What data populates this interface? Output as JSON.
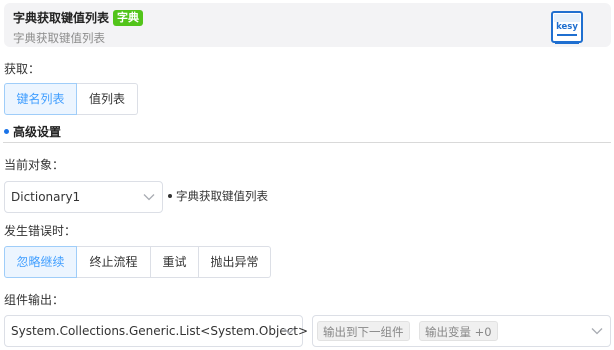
{
  "header": {
    "title": "字典获取键值列表",
    "tag": "字典",
    "subtitle": "字典获取键值列表",
    "logo_text": "kesy"
  },
  "fetch": {
    "label": "获取：",
    "options": [
      "键名列表",
      "值列表"
    ],
    "selected": "键名列表"
  },
  "advanced": {
    "title": "高级设置"
  },
  "current_object": {
    "label": "当前对象：",
    "value": "Dictionary1",
    "note": "字典获取键值列表"
  },
  "on_error": {
    "label": "发生错误时：",
    "options": [
      "忽略继续",
      "终止流程",
      "重试",
      "抛出异常"
    ],
    "selected": "忽略继续"
  },
  "output": {
    "label": "组件输出：",
    "type_value": "System.Collections.Generic.List<System.Object>",
    "chips": [
      "输出到下一组件",
      "输出变量 +0"
    ]
  },
  "colors": {
    "accent": "#409eff",
    "tag_green": "#52c41a",
    "section_dot": "#1a73e8"
  }
}
